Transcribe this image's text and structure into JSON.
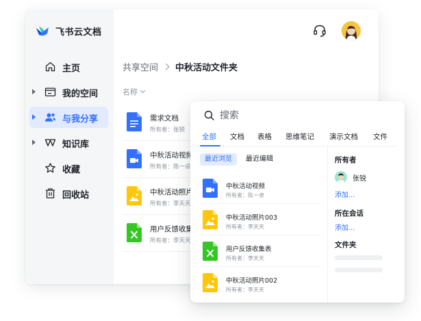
{
  "app": {
    "brand_name": "飞书云文档"
  },
  "sidebar": {
    "items": [
      {
        "label": "主页",
        "icon": "home-icon",
        "has_caret": false,
        "active": false
      },
      {
        "label": "我的空间",
        "icon": "folder-icon",
        "has_caret": true,
        "active": false
      },
      {
        "label": "与我分享",
        "icon": "users-icon",
        "has_caret": true,
        "active": true
      },
      {
        "label": "知识库",
        "icon": "wiki-icon",
        "has_caret": true,
        "active": false
      },
      {
        "label": "收藏",
        "icon": "star-icon",
        "has_caret": false,
        "active": false
      },
      {
        "label": "回收站",
        "icon": "trash-icon",
        "has_caret": false,
        "active": false
      }
    ]
  },
  "header": {
    "support_icon": "headset-icon",
    "avatar_icon": "user-avatar"
  },
  "breadcrumb": {
    "root": "共享空间",
    "current": "中秋活动文件夹"
  },
  "sort": {
    "label": "名称"
  },
  "files": [
    {
      "name": "需求文档",
      "owner": "所有者：张锐",
      "type": "doc"
    },
    {
      "name": "中秋活动视频",
      "owner": "所有者：陈一卓",
      "type": "video"
    },
    {
      "name": "中秋活动照片",
      "owner": "所有者：李天天",
      "type": "image"
    },
    {
      "name": "用户反馈收集",
      "owner": "所有者：李天天",
      "type": "sheet"
    }
  ],
  "search": {
    "placeholder": "搜索",
    "tabs": [
      "全部",
      "文档",
      "表格",
      "思维笔记",
      "演示文档",
      "文件"
    ],
    "active_tab": "全部",
    "subtabs": [
      "最近浏览",
      "最近编辑"
    ],
    "active_subtab": "最近浏览",
    "results": [
      {
        "name": "中秋活动视频",
        "owner": "所有者：陈一卓",
        "type": "video"
      },
      {
        "name": "中秋活动照片003",
        "owner": "所有者：李天天",
        "type": "image"
      },
      {
        "name": "用户反馈收集表",
        "owner": "所有者：李天天",
        "type": "sheet"
      },
      {
        "name": "中秋活动照片002",
        "owner": "所有者：李天天",
        "type": "image"
      }
    ],
    "filters": {
      "owner_title": "所有者",
      "owner_name": "张锐",
      "owner_add": "添加...",
      "chat_title": "所在会话",
      "chat_add": "添加...",
      "folder_title": "文件夹"
    }
  },
  "colors": {
    "accent": "#3370ff",
    "doc": "#3370ff",
    "video": "#3370ff",
    "image": "#ffc60a",
    "sheet": "#34c724"
  }
}
